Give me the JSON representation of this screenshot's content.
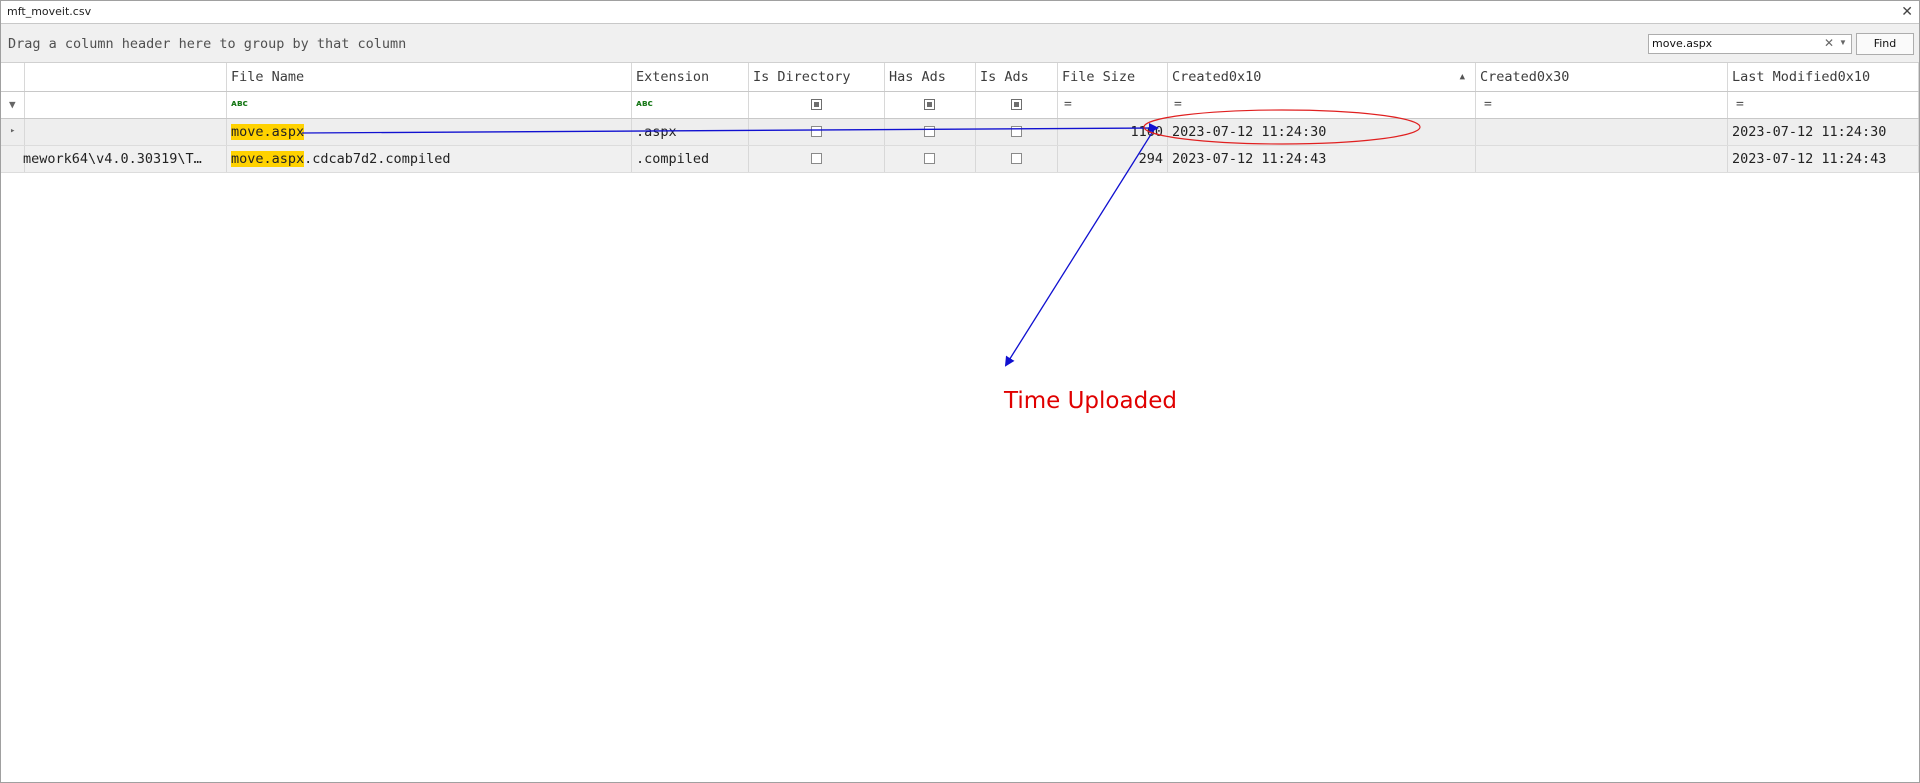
{
  "window": {
    "title": "mft_moveit.csv",
    "close_icon": "close-icon"
  },
  "groupbar": {
    "hint": "Drag a column header here to group by that column"
  },
  "search": {
    "value": "move.aspx",
    "find_label": "Find"
  },
  "columns": [
    "File Name",
    "Extension",
    "Is Directory",
    "Has Ads",
    "Is Ads",
    "File Size",
    "Created0x10",
    "Created0x30",
    "Last Modified0x10"
  ],
  "rows": [
    {
      "path": "",
      "name_hl": "move.aspx",
      "name_rest": "",
      "extension": ".aspx",
      "is_directory": false,
      "has_ads": false,
      "is_ads": false,
      "file_size": "1160",
      "created0x10": "2023-07-12 11:24:30",
      "created0x30": "",
      "last_modified0x10": "2023-07-12 11:24:30"
    },
    {
      "path": "mework64\\v4.0.30319\\T…",
      "name_hl": "move.aspx",
      "name_rest": ".cdcab7d2.compiled",
      "extension": ".compiled",
      "is_directory": false,
      "has_ads": false,
      "is_ads": false,
      "file_size": "294",
      "created0x10": "2023-07-12 11:24:43",
      "created0x30": "",
      "last_modified0x10": "2023-07-12 11:24:43"
    }
  ],
  "annotation": {
    "text": "Time Uploaded",
    "color": "#e00000",
    "arrow_color": "#1010d0"
  }
}
